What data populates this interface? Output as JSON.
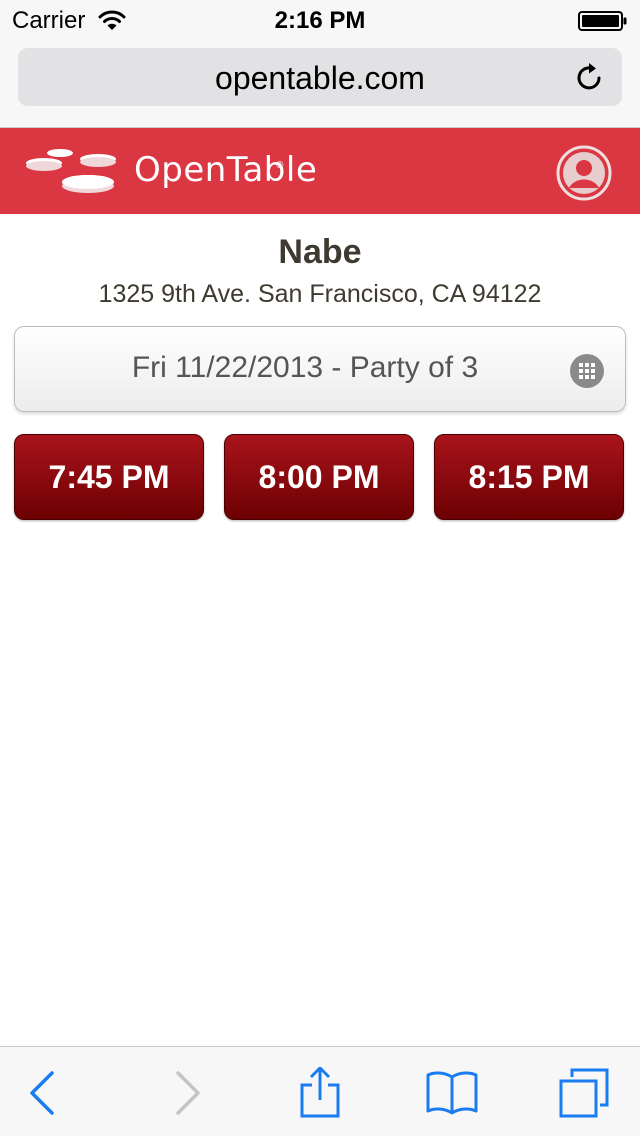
{
  "status_bar": {
    "carrier": "Carrier",
    "time": "2:16 PM"
  },
  "browser": {
    "url": "opentable.com"
  },
  "header": {
    "logo_text": "OpenTable",
    "logo_reg": "®",
    "brand_color": "#da3743"
  },
  "restaurant": {
    "name": "Nabe",
    "address": "1325 9th Ave. San Francisco, CA 94122"
  },
  "search": {
    "date_party": "Fri 11/22/2013 - Party of 3"
  },
  "time_slots": [
    {
      "label": "7:45 PM"
    },
    {
      "label": "8:00 PM"
    },
    {
      "label": "8:15 PM"
    }
  ],
  "toolbar": {
    "accent_color": "#1a7cf0",
    "icons": [
      "back-icon",
      "forward-icon",
      "share-icon",
      "bookmarks-icon",
      "tabs-icon"
    ]
  }
}
